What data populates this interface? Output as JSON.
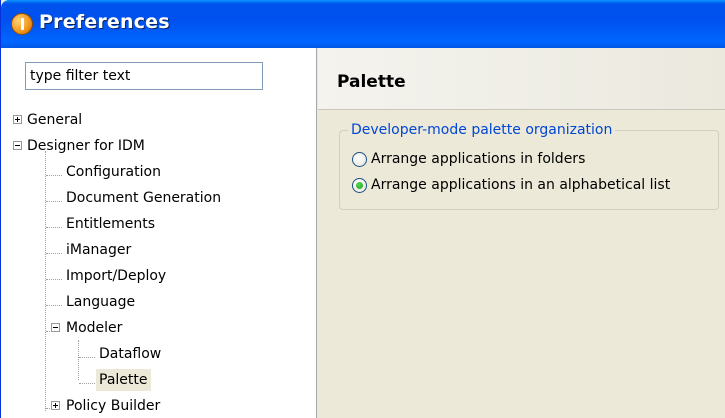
{
  "window": {
    "title": "Preferences",
    "title_icon": "preferences-icon"
  },
  "sidebar": {
    "filter": {
      "value": "type filter text",
      "placeholder": ""
    },
    "tree": [
      {
        "id": "general",
        "label": "General",
        "expander": "plus",
        "level": 0,
        "selected": false
      },
      {
        "id": "designer-for-idm",
        "label": "Designer for IDM",
        "expander": "minus",
        "level": 0,
        "selected": false
      },
      {
        "id": "configuration",
        "label": "Configuration",
        "expander": null,
        "level": 1,
        "selected": false
      },
      {
        "id": "document-generation",
        "label": "Document Generation",
        "expander": null,
        "level": 1,
        "selected": false
      },
      {
        "id": "entitlements",
        "label": "Entitlements",
        "expander": null,
        "level": 1,
        "selected": false
      },
      {
        "id": "imanager",
        "label": "iManager",
        "expander": null,
        "level": 1,
        "selected": false
      },
      {
        "id": "import-deploy",
        "label": "Import/Deploy",
        "expander": null,
        "level": 1,
        "selected": false
      },
      {
        "id": "language",
        "label": "Language",
        "expander": null,
        "level": 1,
        "selected": false
      },
      {
        "id": "modeler",
        "label": "Modeler",
        "expander": "minus",
        "level": 1,
        "selected": false
      },
      {
        "id": "dataflow",
        "label": "Dataflow",
        "expander": null,
        "level": 2,
        "selected": false
      },
      {
        "id": "palette",
        "label": "Palette",
        "expander": null,
        "level": 2,
        "selected": true
      },
      {
        "id": "policy-builder",
        "label": "Policy Builder",
        "expander": "plus",
        "level": 1,
        "selected": false
      }
    ]
  },
  "main": {
    "title": "Palette",
    "group": {
      "legend": "Developer-mode palette organization",
      "options": [
        {
          "id": "folders",
          "label": "Arrange applications in folders",
          "checked": false
        },
        {
          "id": "alphabetical",
          "label": "Arrange applications in an alphabetical list",
          "checked": true
        }
      ]
    }
  },
  "colors": {
    "titlebar": "#0053ee",
    "legend_text": "#0046d5",
    "radio_checked": "#21a121",
    "selection": "#ece9d8"
  }
}
